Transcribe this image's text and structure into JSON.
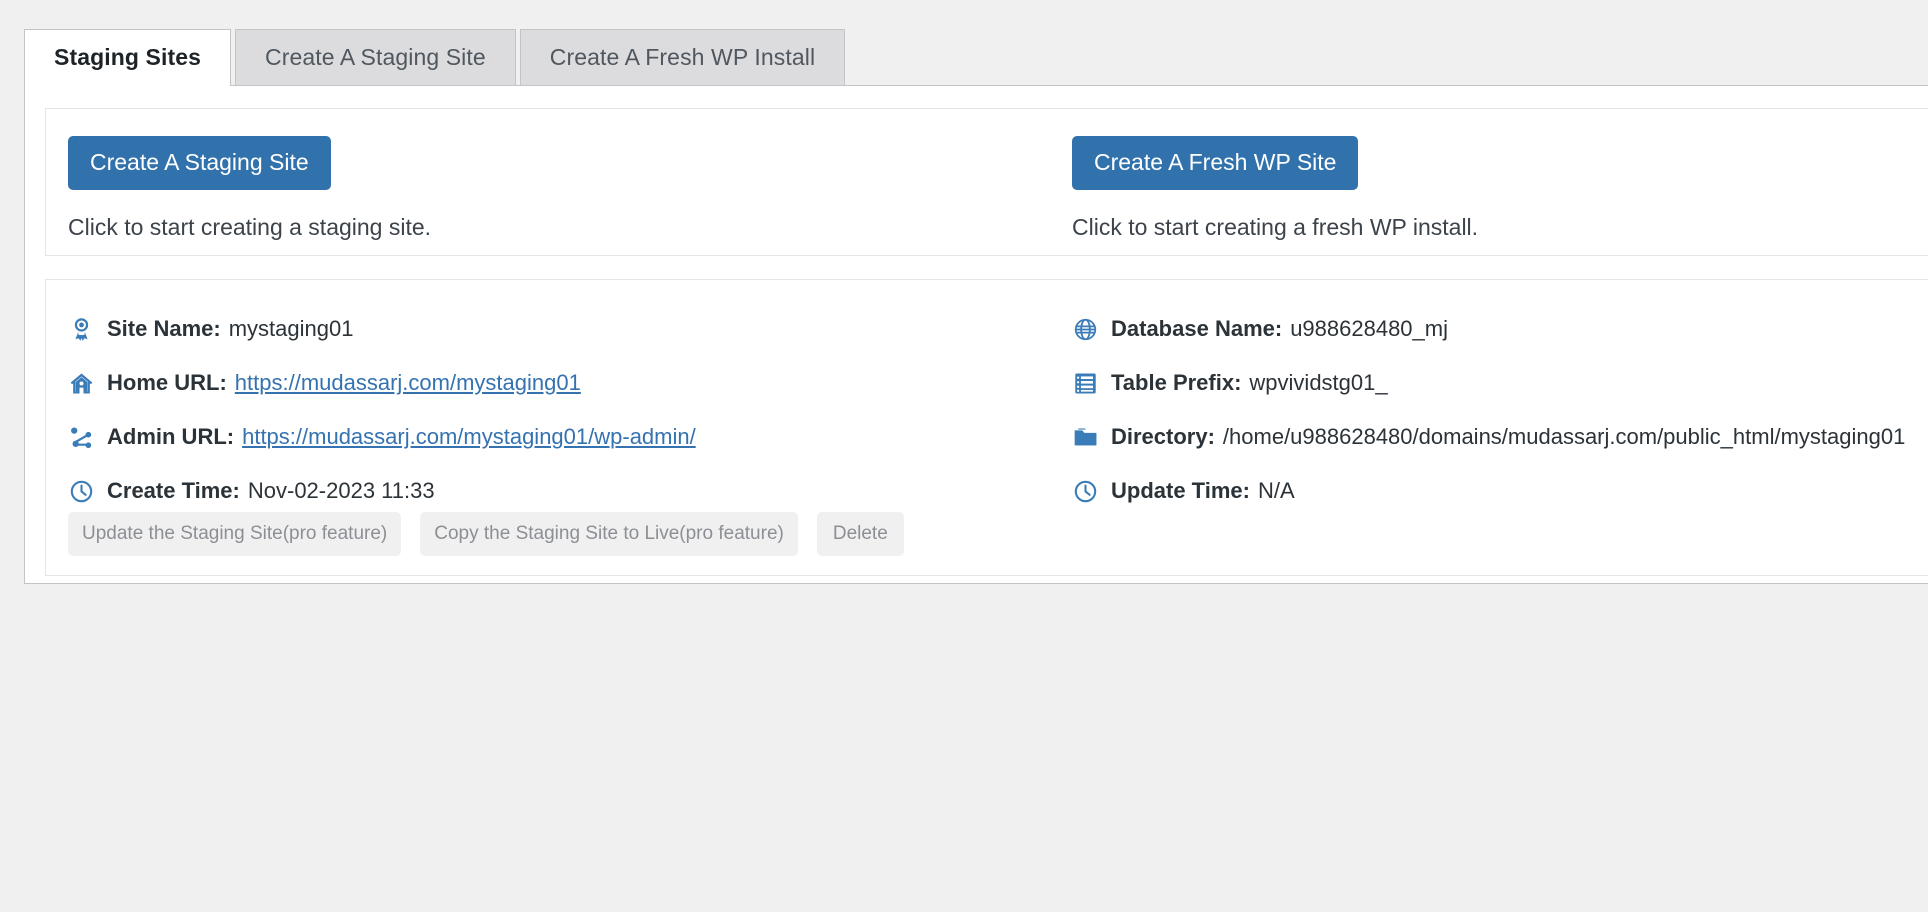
{
  "tabs": [
    {
      "label": "Staging Sites",
      "active": true
    },
    {
      "label": "Create A Staging Site",
      "active": false
    },
    {
      "label": "Create A Fresh WP Install",
      "active": false
    }
  ],
  "create_section": {
    "staging": {
      "button_label": "Create A Staging Site",
      "hint": "Click to start creating a staging site."
    },
    "fresh": {
      "button_label": "Create A Fresh WP Site",
      "hint": "Click to start creating a fresh WP install."
    }
  },
  "site_info": {
    "left": [
      {
        "icon": "award-ribbon-icon",
        "label": "Site Name:",
        "value": "mystaging01",
        "type": "text"
      },
      {
        "icon": "home-icon",
        "label": "Home URL:",
        "value": "https://mudassarj.com/mystaging01",
        "type": "link"
      },
      {
        "icon": "sitemap-icon",
        "label": "Admin URL:",
        "value": "https://mudassarj.com/mystaging01/wp-admin/",
        "type": "link"
      },
      {
        "icon": "clock-icon",
        "label": "Create Time:",
        "value": "Nov-02-2023 11:33",
        "type": "text"
      }
    ],
    "right": [
      {
        "icon": "globe-icon",
        "label": "Database Name:",
        "value": "u988628480_mj",
        "type": "text"
      },
      {
        "icon": "list-icon",
        "label": "Table Prefix:",
        "value": "wpvividstg01_",
        "type": "text"
      },
      {
        "icon": "folder-icon",
        "label": "Directory:",
        "value": "/home/u988628480/domains/mudassarj.com/public_html/mystaging01",
        "type": "text"
      },
      {
        "icon": "clock-icon",
        "label": "Update Time:",
        "value": "N/A",
        "type": "text"
      }
    ]
  },
  "actions": [
    {
      "label": "Update the Staging Site(pro feature)",
      "name": "update-staging-site-button"
    },
    {
      "label": "Copy the Staging Site to Live(pro feature)",
      "name": "copy-staging-to-live-button"
    },
    {
      "label": "Delete",
      "name": "delete-staging-site-button"
    }
  ],
  "colors": {
    "accent_blue": "#3172ad",
    "link_blue": "#3572b0",
    "icon_blue": "#3a7cb8",
    "page_bg": "#f0f0f1",
    "panel_bg": "#ffffff",
    "border": "#c3c4c7",
    "muted_text": "#8c8f94",
    "tab_inactive_bg": "#dcdcde"
  }
}
